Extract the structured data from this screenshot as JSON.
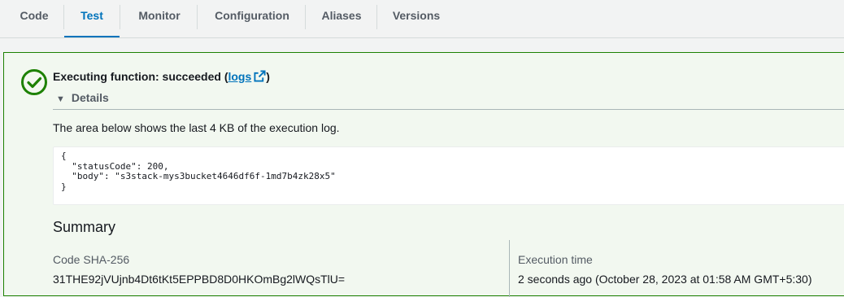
{
  "tabs": [
    {
      "label": "Code"
    },
    {
      "label": "Test"
    },
    {
      "label": "Monitor"
    },
    {
      "label": "Configuration"
    },
    {
      "label": "Aliases"
    },
    {
      "label": "Versions"
    }
  ],
  "active_tab": "Test",
  "colors": {
    "accent": "#0073bb",
    "success": "#1d8102",
    "panel_bg": "#f2f8f0"
  },
  "result": {
    "status_prefix": "Executing function: succeeded (",
    "logs_link": "logs",
    "status_suffix": ")",
    "details_label": "Details",
    "description": "The area below shows the last 4 KB of the execution log.",
    "log_output": "{\n  \"statusCode\": 200,\n  \"body\": \"s3stack-mys3bucket4646df6f-1md7b4zk28x5\"\n}"
  },
  "summary": {
    "title": "Summary",
    "code_sha_label": "Code SHA-256",
    "code_sha_value": "31THE92jVUjnb4Dt6tKt5EPPBD8D0HKOmBg2lWQsTlU=",
    "execution_time_label": "Execution time",
    "execution_time_value": "2 seconds ago (October 28, 2023 at 01:58 AM GMT+5:30)"
  }
}
